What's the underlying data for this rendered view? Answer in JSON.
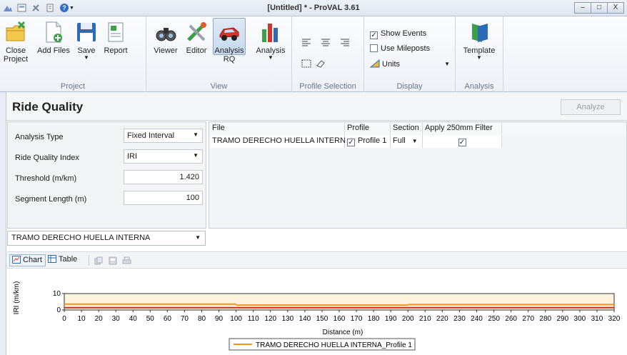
{
  "window": {
    "title": "[Untitled] * - ProVAL 3.61",
    "help_label": "?",
    "minimize": "–",
    "maximize": "□",
    "close": "X"
  },
  "ribbon": {
    "groups": {
      "project": "Project",
      "view": "View",
      "profile_selection": "Profile Selection",
      "display": "Display",
      "analysis": "Analysis"
    },
    "buttons": {
      "close_project_1": "Close",
      "close_project_2": "Project",
      "add_files": "Add Files",
      "save": "Save",
      "report": "Report",
      "viewer": "Viewer",
      "editor": "Editor",
      "analysis_rq_1": "Analysis",
      "analysis_rq_2": "RQ",
      "analysis": "Analysis",
      "template": "Template"
    },
    "display": {
      "show_events": "Show Events",
      "show_events_checked": true,
      "use_mileposts": "Use Mileposts",
      "use_mileposts_checked": false,
      "units": "Units"
    }
  },
  "panel": {
    "title": "Ride Quality",
    "analyze_button": "Analyze"
  },
  "params": {
    "analysis_type_label": "Analysis Type",
    "analysis_type_value": "Fixed Interval",
    "rqi_label": "Ride Quality Index",
    "rqi_value": "IRI",
    "threshold_label": "Threshold (m/km)",
    "threshold_value": "1.420",
    "segment_label": "Segment Length (m)",
    "segment_value": "100"
  },
  "grid": {
    "headers": {
      "file": "File",
      "profile": "Profile",
      "section": "Section",
      "filter": "Apply 250mm Filter"
    },
    "row": {
      "file": "TRAMO DERECHO HUELLA INTERNA",
      "profile": "Profile 1",
      "profile_checked": true,
      "section": "Full",
      "filter_checked": true
    }
  },
  "file_select": "TRAMO DERECHO HUELLA INTERNA",
  "tabs": {
    "chart": "Chart",
    "table": "Table"
  },
  "chart_data": {
    "type": "line",
    "xlabel": "Distance (m)",
    "ylabel": "IRI (m/km)",
    "xlim": [
      0,
      320
    ],
    "ylim": [
      0,
      10
    ],
    "y_ticks": [
      "10",
      "0"
    ],
    "x_ticks": [
      0,
      10,
      20,
      30,
      40,
      50,
      60,
      70,
      80,
      90,
      100,
      110,
      120,
      130,
      140,
      150,
      160,
      170,
      180,
      190,
      200,
      210,
      220,
      230,
      240,
      250,
      260,
      270,
      280,
      290,
      300,
      310,
      320
    ],
    "threshold": 1.42,
    "threshold_color": "#d9261c",
    "series": [
      {
        "name": "TRAMO DERECHO HUELLA INTERNA_Profile 1",
        "color": "#f0961e",
        "segments": [
          {
            "x0": 0,
            "x1": 100,
            "y": 3.6
          },
          {
            "x0": 100,
            "x1": 200,
            "y": 3.0
          },
          {
            "x0": 200,
            "x1": 320,
            "y": 3.3
          }
        ]
      }
    ],
    "legend_position": "bottom-center"
  }
}
